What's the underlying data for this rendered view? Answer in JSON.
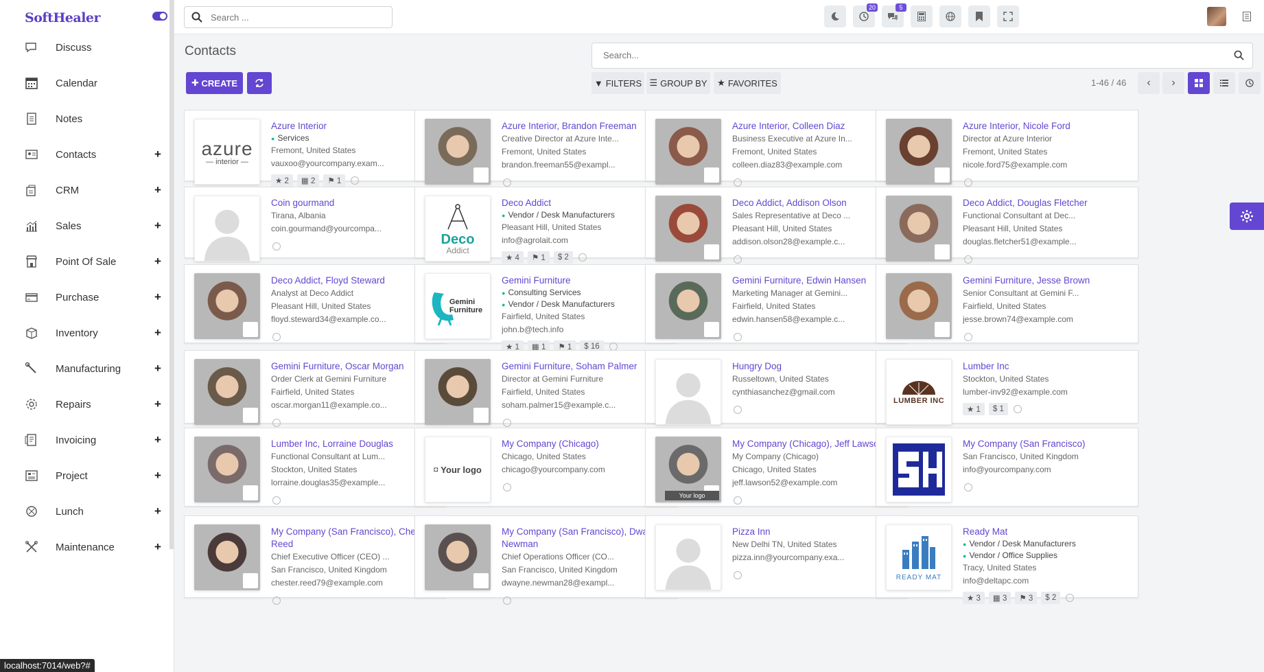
{
  "brand": "SoftHealer",
  "menu": [
    {
      "label": "Discuss",
      "icon": "chat-icon",
      "plus": false
    },
    {
      "label": "Calendar",
      "icon": "calendar-icon",
      "plus": false
    },
    {
      "label": "Notes",
      "icon": "notes-icon",
      "plus": false
    },
    {
      "label": "Contacts",
      "icon": "contacts-icon",
      "plus": true
    },
    {
      "label": "CRM",
      "icon": "crm-icon",
      "plus": true
    },
    {
      "label": "Sales",
      "icon": "sales-chart-icon",
      "plus": true
    },
    {
      "label": "Point Of Sale",
      "icon": "store-icon",
      "plus": true
    },
    {
      "label": "Purchase",
      "icon": "credit-card-icon",
      "plus": true
    },
    {
      "label": "Inventory",
      "icon": "box-icon",
      "plus": true
    },
    {
      "label": "Manufacturing",
      "icon": "wrench-icon",
      "plus": true
    },
    {
      "label": "Repairs",
      "icon": "gear-icon",
      "plus": true
    },
    {
      "label": "Invoicing",
      "icon": "invoice-icon",
      "plus": true
    },
    {
      "label": "Project",
      "icon": "project-icon",
      "plus": true
    },
    {
      "label": "Lunch",
      "icon": "lunch-icon",
      "plus": true
    },
    {
      "label": "Maintenance",
      "icon": "tools-icon",
      "plus": true
    }
  ],
  "plus_symbol": "+",
  "status_url": "localhost:7014/web?#",
  "topbar": {
    "search_placeholder": "Search ...",
    "activity_count": "20",
    "messages_count": "5"
  },
  "page": {
    "title": "Contacts",
    "create_label": "CREATE",
    "search_placeholder": "Search...",
    "filters_label": "FILTERS",
    "groupby_label": "GROUP BY",
    "favorites_label": "FAVORITES",
    "pager": "1-46 / 46"
  },
  "colors": {
    "accent": "#6346d1",
    "tag_dot": "#21b799",
    "link": "#6346d1"
  },
  "cards": [
    {
      "name": "Azure Interior",
      "tags": [
        "Services"
      ],
      "lines": [
        "Fremont, United States",
        "vauxoo@yourcompany.exam..."
      ],
      "chips": [
        "★ 2",
        "▦ 2",
        "⚑ 1"
      ],
      "thumb": "azure-logo",
      "logo_text": "azure",
      "logo_sub": "— interior —"
    },
    {
      "name": "Azure Interior, Brandon Freeman",
      "tags": [],
      "lines": [
        "Creative Director at Azure Inte...",
        "Fremont, United States",
        "brandon.freeman55@exampl..."
      ],
      "chips": [],
      "thumb": "photo",
      "tone": "#7a6a5a"
    },
    {
      "name": "Azure Interior, Colleen Diaz",
      "tags": [],
      "lines": [
        "Business Executive at Azure In...",
        "Fremont, United States",
        "colleen.diaz83@example.com"
      ],
      "chips": [],
      "thumb": "photo",
      "tone": "#8a5a4a"
    },
    {
      "name": "Azure Interior, Nicole Ford",
      "tags": [],
      "lines": [
        "Director at Azure Interior",
        "Fremont, United States",
        "nicole.ford75@example.com"
      ],
      "chips": [],
      "thumb": "photo",
      "tone": "#6a4030"
    },
    {
      "name": "Coin gourmand",
      "tags": [],
      "lines": [
        "Tirana, Albania",
        "coin.gourmand@yourcompa..."
      ],
      "chips": [],
      "thumb": "placeholder"
    },
    {
      "name": "Deco Addict",
      "tags": [
        "Vendor / Desk Manufacturers"
      ],
      "lines": [
        "Pleasant Hill, United States",
        "info@agrolait.com"
      ],
      "chips": [
        "★ 4",
        "⚑ 1",
        "$ 2"
      ],
      "thumb": "deco-logo",
      "logo_text": "Deco",
      "logo_sub": "Addict"
    },
    {
      "name": "Deco Addict, Addison Olson",
      "tags": [],
      "lines": [
        "Sales Representative at Deco ...",
        "Pleasant Hill, United States",
        "addison.olson28@example.c..."
      ],
      "chips": [],
      "thumb": "photo",
      "tone": "#9a4a3a"
    },
    {
      "name": "Deco Addict, Douglas Fletcher",
      "tags": [],
      "lines": [
        "Functional Consultant at Dec...",
        "Pleasant Hill, United States",
        "douglas.fletcher51@example..."
      ],
      "chips": [],
      "thumb": "photo",
      "tone": "#8a6a5a"
    },
    {
      "name": "Deco Addict, Floyd Steward",
      "tags": [],
      "lines": [
        "Analyst at Deco Addict",
        "Pleasant Hill, United States",
        "floyd.steward34@example.co..."
      ],
      "chips": [],
      "thumb": "photo",
      "tone": "#7a5a4a"
    },
    {
      "name": "Gemini Furniture",
      "tags": [
        "Consulting Services",
        "Vendor / Desk Manufacturers"
      ],
      "lines": [
        "Fairfield, United States",
        "john.b@tech.info"
      ],
      "chips": [
        "★ 1",
        "▦ 1",
        "⚑ 1",
        "$ 16"
      ],
      "thumb": "gemini-logo",
      "logo_text": "Gemini",
      "logo_sub": "Furniture"
    },
    {
      "name": "Gemini Furniture, Edwin Hansen",
      "tags": [],
      "lines": [
        "Marketing Manager at Gemini...",
        "Fairfield, United States",
        "edwin.hansen58@example.c..."
      ],
      "chips": [],
      "thumb": "photo",
      "tone": "#5a6a5a"
    },
    {
      "name": "Gemini Furniture, Jesse Brown",
      "tags": [],
      "lines": [
        "Senior Consultant at Gemini F...",
        "Fairfield, United States",
        "jesse.brown74@example.com"
      ],
      "chips": [],
      "thumb": "photo",
      "tone": "#9a6a4a"
    },
    {
      "name": "Gemini Furniture, Oscar Morgan",
      "tags": [],
      "lines": [
        "Order Clerk at Gemini Furniture",
        "Fairfield, United States",
        "oscar.morgan11@example.co..."
      ],
      "chips": [],
      "thumb": "photo",
      "tone": "#6a5a4a"
    },
    {
      "name": "Gemini Furniture, Soham Palmer",
      "tags": [],
      "lines": [
        "Director at Gemini Furniture",
        "Fairfield, United States",
        "soham.palmer15@example.c..."
      ],
      "chips": [],
      "thumb": "photo",
      "tone": "#5a4a3a"
    },
    {
      "name": "Hungry Dog",
      "tags": [],
      "lines": [
        "Russeltown, United States",
        "cynthiasanchez@gmail.com"
      ],
      "chips": [],
      "thumb": "placeholder"
    },
    {
      "name": "Lumber Inc",
      "tags": [],
      "lines": [
        "Stockton, United States",
        "lumber-inv92@example.com"
      ],
      "chips": [
        "★ 1",
        "$ 1"
      ],
      "thumb": "lumber-logo",
      "logo_text": "LUMBER INC",
      "logo_sub": ""
    },
    {
      "name": "Lumber Inc, Lorraine Douglas",
      "tags": [],
      "lines": [
        "Functional Consultant at Lum...",
        "Stockton, United States",
        "lorraine.douglas35@example..."
      ],
      "chips": [],
      "thumb": "photo",
      "tone": "#7a6a6a"
    },
    {
      "name": "My Company (Chicago)",
      "tags": [],
      "lines": [
        "Chicago, United States",
        "chicago@yourcompany.com"
      ],
      "chips": [],
      "thumb": "yourlogo",
      "logo_text": "Your logo",
      "logo_sub": ""
    },
    {
      "name": "My Company (Chicago), Jeff Lawson",
      "tags": [],
      "lines": [
        "My Company (Chicago)",
        "Chicago, United States",
        "jeff.lawson52@example.com"
      ],
      "chips": [],
      "thumb": "photo",
      "tone": "#6a6a6a",
      "thumb_label": "Your logo"
    },
    {
      "name": "My Company (San Francisco)",
      "tags": [],
      "lines": [
        "San Francisco, United Kingdom",
        "info@yourcompany.com"
      ],
      "chips": [],
      "thumb": "sh-logo",
      "logo_text": "SH",
      "logo_sub": ""
    },
    {
      "name": "My Company (San Francisco), Chester Reed",
      "tags": [],
      "lines": [
        "Chief Executive Officer (CEO) ...",
        "San Francisco, United Kingdom",
        "chester.reed79@example.com"
      ],
      "chips": [],
      "thumb": "photo",
      "tone": "#4a3a3a"
    },
    {
      "name": "My Company (San Francisco), Dwayne Newman",
      "tags": [],
      "lines": [
        "Chief Operations Officer (CO...",
        "San Francisco, United Kingdom",
        "dwayne.newman28@exampl..."
      ],
      "chips": [],
      "thumb": "photo",
      "tone": "#5a5050"
    },
    {
      "name": "Pizza Inn",
      "tags": [],
      "lines": [
        "New Delhi TN, United States",
        "pizza.inn@yourcompany.exa..."
      ],
      "chips": [],
      "thumb": "placeholder"
    },
    {
      "name": "Ready Mat",
      "tags": [
        "Vendor / Desk Manufacturers",
        "Vendor / Office Supplies"
      ],
      "lines": [
        "Tracy, United States",
        "info@deltapc.com"
      ],
      "chips": [
        "★ 3",
        "▦ 3",
        "⚑ 3",
        "$ 2"
      ],
      "thumb": "readymat-logo",
      "logo_text": "READY MAT",
      "logo_sub": ""
    }
  ]
}
